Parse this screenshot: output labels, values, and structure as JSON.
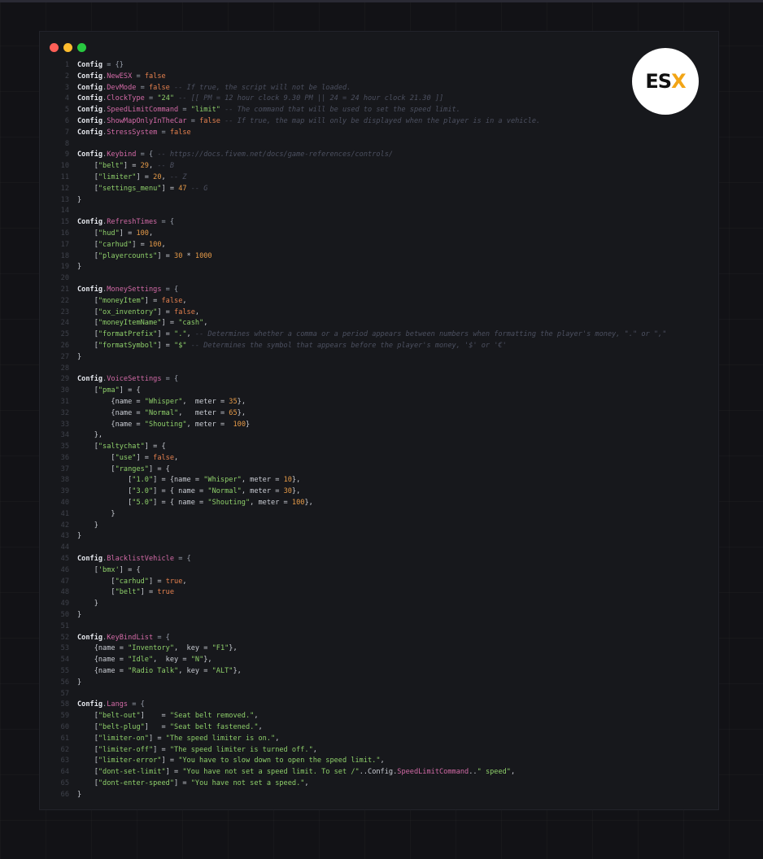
{
  "window": {
    "controls": [
      {
        "name": "close",
        "color": "#ff5f57"
      },
      {
        "name": "minimize",
        "color": "#febc2e"
      },
      {
        "name": "maximize",
        "color": "#28c840"
      }
    ]
  },
  "logo": {
    "text_main": "ES",
    "text_accent": "X",
    "accent_color": "#f2a516"
  },
  "code": {
    "lines": [
      [
        [
          "kw",
          "Config"
        ],
        [
          "op",
          " = {}"
        ]
      ],
      [
        [
          "kw",
          "Config"
        ],
        [
          "op",
          "."
        ],
        [
          "prop",
          "NewESX"
        ],
        [
          "op",
          " = "
        ],
        [
          "bool",
          "false"
        ]
      ],
      [
        [
          "kw",
          "Config"
        ],
        [
          "op",
          "."
        ],
        [
          "prop",
          "DevMode"
        ],
        [
          "op",
          " = "
        ],
        [
          "bool",
          "false"
        ],
        [
          "com",
          " -- If true, the script will not be loaded."
        ]
      ],
      [
        [
          "kw",
          "Config"
        ],
        [
          "op",
          "."
        ],
        [
          "prop",
          "ClockType"
        ],
        [
          "op",
          " = "
        ],
        [
          "str",
          "\"24\""
        ],
        [
          "com",
          " -- [[ PM = 12 hour clock 9.30 PM || 24 = 24 hour clock 21.30 ]]"
        ]
      ],
      [
        [
          "kw",
          "Config"
        ],
        [
          "op",
          "."
        ],
        [
          "prop",
          "SpeedLimitCommand"
        ],
        [
          "op",
          " = "
        ],
        [
          "str",
          "\"limit\""
        ],
        [
          "com",
          " -- The command that will be used to set the speed limit."
        ]
      ],
      [
        [
          "kw",
          "Config"
        ],
        [
          "op",
          "."
        ],
        [
          "prop",
          "ShowMapOnlyInTheCar"
        ],
        [
          "op",
          " = "
        ],
        [
          "bool",
          "false"
        ],
        [
          "com",
          " -- If true, the map will only be displayed when the player is in a vehicle."
        ]
      ],
      [
        [
          "kw",
          "Config"
        ],
        [
          "op",
          "."
        ],
        [
          "prop",
          "StressSystem"
        ],
        [
          "op",
          " = "
        ],
        [
          "bool",
          "false"
        ]
      ],
      [],
      [
        [
          "kw",
          "Config"
        ],
        [
          "op",
          "."
        ],
        [
          "prop",
          "Keybind"
        ],
        [
          "op",
          " = { "
        ],
        [
          "com",
          "-- https://docs.fivem.net/docs/game-references/controls/"
        ]
      ],
      [
        [
          "pl",
          "    ["
        ],
        [
          "str",
          "\"belt\""
        ],
        [
          "pl",
          "] = "
        ],
        [
          "num",
          "29"
        ],
        [
          "pl",
          ", "
        ],
        [
          "com",
          "-- B"
        ]
      ],
      [
        [
          "pl",
          "    ["
        ],
        [
          "str",
          "\"limiter\""
        ],
        [
          "pl",
          "] = "
        ],
        [
          "num",
          "20"
        ],
        [
          "pl",
          ", "
        ],
        [
          "com",
          "-- Z"
        ]
      ],
      [
        [
          "pl",
          "    ["
        ],
        [
          "str",
          "\"settings_menu\""
        ],
        [
          "pl",
          "] = "
        ],
        [
          "num",
          "47"
        ],
        [
          "pl",
          " "
        ],
        [
          "com",
          "-- G"
        ]
      ],
      [
        [
          "pl",
          "}"
        ]
      ],
      [],
      [
        [
          "kw",
          "Config"
        ],
        [
          "op",
          "."
        ],
        [
          "prop",
          "RefreshTimes"
        ],
        [
          "op",
          " = {"
        ]
      ],
      [
        [
          "pl",
          "    ["
        ],
        [
          "str",
          "\"hud\""
        ],
        [
          "pl",
          "] = "
        ],
        [
          "num",
          "100"
        ],
        [
          "pl",
          ","
        ]
      ],
      [
        [
          "pl",
          "    ["
        ],
        [
          "str",
          "\"carhud\""
        ],
        [
          "pl",
          "] = "
        ],
        [
          "num",
          "100"
        ],
        [
          "pl",
          ","
        ]
      ],
      [
        [
          "pl",
          "    ["
        ],
        [
          "str",
          "\"playercounts\""
        ],
        [
          "pl",
          "] = "
        ],
        [
          "num",
          "30"
        ],
        [
          "pl",
          " * "
        ],
        [
          "num",
          "1000"
        ]
      ],
      [
        [
          "pl",
          "}"
        ]
      ],
      [],
      [
        [
          "kw",
          "Config"
        ],
        [
          "op",
          "."
        ],
        [
          "prop",
          "MoneySettings"
        ],
        [
          "op",
          " = {"
        ]
      ],
      [
        [
          "pl",
          "    ["
        ],
        [
          "str",
          "\"moneyItem\""
        ],
        [
          "pl",
          "] = "
        ],
        [
          "bool",
          "false"
        ],
        [
          "pl",
          ","
        ]
      ],
      [
        [
          "pl",
          "    ["
        ],
        [
          "str",
          "\"ox_inventory\""
        ],
        [
          "pl",
          "] = "
        ],
        [
          "bool",
          "false"
        ],
        [
          "pl",
          ","
        ]
      ],
      [
        [
          "pl",
          "    ["
        ],
        [
          "str",
          "\"moneyItemName\""
        ],
        [
          "pl",
          "] = "
        ],
        [
          "str",
          "\"cash\""
        ],
        [
          "pl",
          ","
        ]
      ],
      [
        [
          "pl",
          "    ["
        ],
        [
          "str",
          "\"formatPrefix\""
        ],
        [
          "pl",
          "] = "
        ],
        [
          "str",
          "\".\""
        ],
        [
          "pl",
          ", "
        ],
        [
          "com",
          "-- Determines whether a comma or a period appears between numbers when formatting the player's money, \".\" or \",\""
        ]
      ],
      [
        [
          "pl",
          "    ["
        ],
        [
          "str",
          "\"formatSymbol\""
        ],
        [
          "pl",
          "] = "
        ],
        [
          "str",
          "\"$\""
        ],
        [
          "pl",
          " "
        ],
        [
          "com",
          "-- Determines the symbol that appears before the player's money, '$' or '€'"
        ]
      ],
      [
        [
          "pl",
          "}"
        ]
      ],
      [],
      [
        [
          "kw",
          "Config"
        ],
        [
          "op",
          "."
        ],
        [
          "prop",
          "VoiceSettings"
        ],
        [
          "op",
          " = {"
        ]
      ],
      [
        [
          "pl",
          "    ["
        ],
        [
          "str",
          "\"pma\""
        ],
        [
          "pl",
          "] = {"
        ]
      ],
      [
        [
          "pl",
          "        {name = "
        ],
        [
          "str",
          "\"Whisper\""
        ],
        [
          "pl",
          ",  meter = "
        ],
        [
          "num",
          "35"
        ],
        [
          "pl",
          "},"
        ]
      ],
      [
        [
          "pl",
          "        {name = "
        ],
        [
          "str",
          "\"Normal\""
        ],
        [
          "pl",
          ",   meter = "
        ],
        [
          "num",
          "65"
        ],
        [
          "pl",
          "},"
        ]
      ],
      [
        [
          "pl",
          "        {name = "
        ],
        [
          "str",
          "\"Shouting\""
        ],
        [
          "pl",
          ", meter =  "
        ],
        [
          "num",
          "100"
        ],
        [
          "pl",
          "}"
        ]
      ],
      [
        [
          "pl",
          "    },"
        ]
      ],
      [
        [
          "pl",
          "    ["
        ],
        [
          "str",
          "\"saltychat\""
        ],
        [
          "pl",
          "] = {"
        ]
      ],
      [
        [
          "pl",
          "        ["
        ],
        [
          "str",
          "\"use\""
        ],
        [
          "pl",
          "] = "
        ],
        [
          "bool",
          "false"
        ],
        [
          "pl",
          ","
        ]
      ],
      [
        [
          "pl",
          "        ["
        ],
        [
          "str",
          "\"ranges\""
        ],
        [
          "pl",
          "] = {"
        ]
      ],
      [
        [
          "pl",
          "            ["
        ],
        [
          "str",
          "\"1.0\""
        ],
        [
          "pl",
          "] = {name = "
        ],
        [
          "str",
          "\"Whisper\""
        ],
        [
          "pl",
          ", meter = "
        ],
        [
          "num",
          "10"
        ],
        [
          "pl",
          "},"
        ]
      ],
      [
        [
          "pl",
          "            ["
        ],
        [
          "str",
          "\"3.0\""
        ],
        [
          "pl",
          "] = { name = "
        ],
        [
          "str",
          "\"Normal\""
        ],
        [
          "pl",
          ", meter = "
        ],
        [
          "num",
          "30"
        ],
        [
          "pl",
          "},"
        ]
      ],
      [
        [
          "pl",
          "            ["
        ],
        [
          "str",
          "\"5.0\""
        ],
        [
          "pl",
          "] = { name = "
        ],
        [
          "str",
          "\"Shouting\""
        ],
        [
          "pl",
          ", meter = "
        ],
        [
          "num",
          "100"
        ],
        [
          "pl",
          "},"
        ]
      ],
      [
        [
          "pl",
          "        }"
        ]
      ],
      [
        [
          "pl",
          "    }"
        ]
      ],
      [
        [
          "pl",
          "}"
        ]
      ],
      [],
      [
        [
          "kw",
          "Config"
        ],
        [
          "op",
          "."
        ],
        [
          "prop",
          "BlacklistVehicle"
        ],
        [
          "op",
          " = {"
        ]
      ],
      [
        [
          "pl",
          "    ["
        ],
        [
          "str",
          "'bmx'"
        ],
        [
          "pl",
          "] = {"
        ]
      ],
      [
        [
          "pl",
          "        ["
        ],
        [
          "str",
          "\"carhud\""
        ],
        [
          "pl",
          "] = "
        ],
        [
          "bool",
          "true"
        ],
        [
          "pl",
          ","
        ]
      ],
      [
        [
          "pl",
          "        ["
        ],
        [
          "str",
          "\"belt\""
        ],
        [
          "pl",
          "] = "
        ],
        [
          "bool",
          "true"
        ]
      ],
      [
        [
          "pl",
          "    }"
        ]
      ],
      [
        [
          "pl",
          "}"
        ]
      ],
      [],
      [
        [
          "kw",
          "Config"
        ],
        [
          "op",
          "."
        ],
        [
          "prop",
          "KeyBindList"
        ],
        [
          "op",
          " = {"
        ]
      ],
      [
        [
          "pl",
          "    {name = "
        ],
        [
          "str",
          "\"Inventory\""
        ],
        [
          "pl",
          ",  key = "
        ],
        [
          "str",
          "\"F1\""
        ],
        [
          "pl",
          "},"
        ]
      ],
      [
        [
          "pl",
          "    {name = "
        ],
        [
          "str",
          "\"Idle\""
        ],
        [
          "pl",
          ",  key = "
        ],
        [
          "str",
          "\"N\""
        ],
        [
          "pl",
          "},"
        ]
      ],
      [
        [
          "pl",
          "    {name = "
        ],
        [
          "str",
          "\"Radio Talk\""
        ],
        [
          "pl",
          ", key = "
        ],
        [
          "str",
          "\"ALT\""
        ],
        [
          "pl",
          "},"
        ]
      ],
      [
        [
          "pl",
          "}"
        ]
      ],
      [],
      [
        [
          "kw",
          "Config"
        ],
        [
          "op",
          "."
        ],
        [
          "prop",
          "Langs"
        ],
        [
          "op",
          " = {"
        ]
      ],
      [
        [
          "pl",
          "    ["
        ],
        [
          "str",
          "\"belt-out\""
        ],
        [
          "pl",
          "]    = "
        ],
        [
          "str",
          "\"Seat belt removed.\""
        ],
        [
          "pl",
          ","
        ]
      ],
      [
        [
          "pl",
          "    ["
        ],
        [
          "str",
          "\"belt-plug\""
        ],
        [
          "pl",
          "]   = "
        ],
        [
          "str",
          "\"Seat belt fastened.\""
        ],
        [
          "pl",
          ","
        ]
      ],
      [
        [
          "pl",
          "    ["
        ],
        [
          "str",
          "\"limiter-on\""
        ],
        [
          "pl",
          "] = "
        ],
        [
          "str",
          "\"The speed limiter is on.\""
        ],
        [
          "pl",
          ","
        ]
      ],
      [
        [
          "pl",
          "    ["
        ],
        [
          "str",
          "\"limiter-off\""
        ],
        [
          "pl",
          "] = "
        ],
        [
          "str",
          "\"The speed limiter is turned off.\""
        ],
        [
          "pl",
          ","
        ]
      ],
      [
        [
          "pl",
          "    ["
        ],
        [
          "str",
          "\"limiter-error\""
        ],
        [
          "pl",
          "] = "
        ],
        [
          "str",
          "\"You have to slow down to open the speed limit.\""
        ],
        [
          "pl",
          ","
        ]
      ],
      [
        [
          "pl",
          "    ["
        ],
        [
          "str",
          "\"dont-set-limit\""
        ],
        [
          "pl",
          "] = "
        ],
        [
          "str",
          "\"You have not set a speed limit. To set /\""
        ],
        [
          "pl",
          "..Config."
        ],
        [
          "prop",
          "SpeedLimitCommand"
        ],
        [
          "pl",
          ".."
        ],
        [
          "str",
          "\" speed\""
        ],
        [
          "pl",
          ","
        ]
      ],
      [
        [
          "pl",
          "    ["
        ],
        [
          "str",
          "\"dont-enter-speed\""
        ],
        [
          "pl",
          "] = "
        ],
        [
          "str",
          "\"You have not set a speed.\""
        ],
        [
          "pl",
          ","
        ]
      ],
      [
        [
          "pl",
          "}"
        ]
      ]
    ]
  }
}
